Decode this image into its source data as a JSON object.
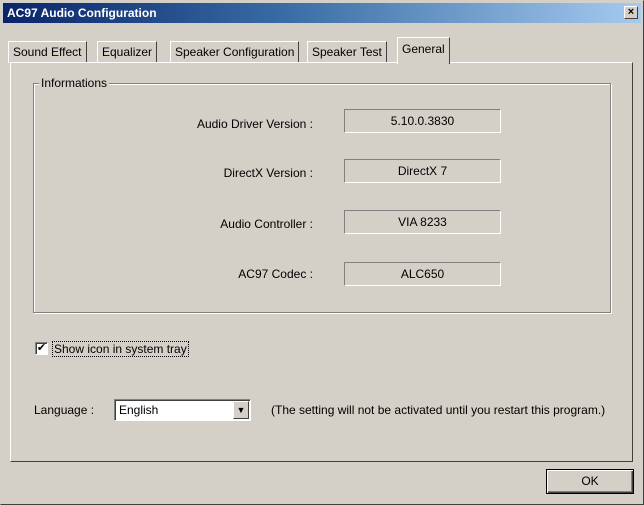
{
  "window": {
    "title": "AC97 Audio Configuration",
    "close_glyph": "×"
  },
  "tabs": [
    {
      "label": "Sound Effect",
      "active": false
    },
    {
      "label": "Equalizer",
      "active": false
    },
    {
      "label": "Speaker Configuration",
      "active": false
    },
    {
      "label": "Speaker Test",
      "active": false
    },
    {
      "label": "General",
      "active": true
    }
  ],
  "info": {
    "group_title": "Informations",
    "rows": [
      {
        "label": "Audio Driver Version :",
        "value": "5.10.0.3830"
      },
      {
        "label": "DirectX Version :",
        "value": "DirectX 7"
      },
      {
        "label": "Audio Controller :",
        "value": "VIA 8233"
      },
      {
        "label": "AC97 Codec :",
        "value": "ALC650"
      }
    ]
  },
  "tray": {
    "label": "Show icon in system tray",
    "checked": true,
    "check_glyph": "✔"
  },
  "language": {
    "label": "Language :",
    "selected": "English",
    "arrow_glyph": "▼",
    "note": "(The setting will not be activated until you restart this program.)"
  },
  "footer": {
    "ok_label": "OK"
  },
  "colors": {
    "face": "#d4d0c8",
    "title_start": "#0a246a",
    "title_end": "#a6caf0"
  }
}
